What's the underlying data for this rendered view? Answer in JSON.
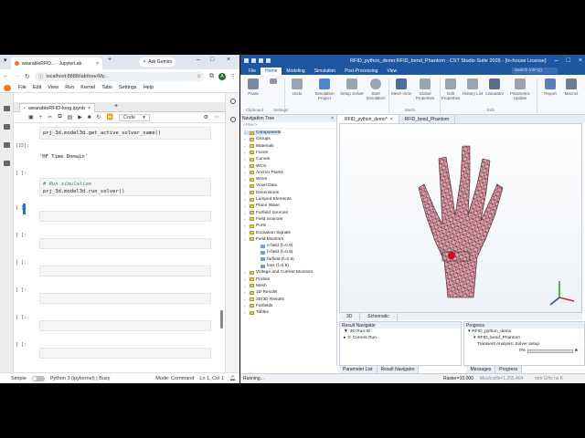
{
  "chrome": {
    "tab_title": "wearableRFID... - JupyterLab",
    "gemini_label": "Ask Gemini",
    "url": "localhost:8888/lab/tree/My...",
    "avatar_letter": "A"
  },
  "jupyter": {
    "menu": [
      "File",
      "Edit",
      "View",
      "Run",
      "Kernel",
      "Tabs",
      "Settings",
      "Help"
    ],
    "notebook_tab": "wearableRFID-long.ipynb",
    "cell_type": "Code",
    "cells": [
      {
        "prompt": "",
        "code": "prj_3d.model3d.get_active_solver_name()"
      },
      {
        "prompt": "[15]:",
        "output": "'HF Time Domain'"
      },
      {
        "prompt": "[ ]:",
        "comment": "# Run simulation",
        "code": "prj_3d.model3d.run_solver()"
      },
      {
        "prompt": "[ ]:"
      },
      {
        "prompt": "[ ]:"
      },
      {
        "prompt": "[ ]:"
      },
      {
        "prompt": "[ ]:"
      },
      {
        "prompt": "[ ]:"
      },
      {
        "prompt": "[ ]:"
      }
    ],
    "status": {
      "mode_label": "Simple",
      "kernel": "Python 3 (ipykernel) | Busy",
      "mode": "Mode: Command",
      "position": "Ln 1, Col 1"
    }
  },
  "cst": {
    "title": "RFID_python_demo:RFID_bend_Phantom - CST Studio Suite 2026 - [In-house License]",
    "tabs": [
      "File",
      "Home",
      "Modeling",
      "Simulation",
      "Post-Processing",
      "View"
    ],
    "active_tab": "Home",
    "search_placeholder": "Search (Alt+Q)",
    "ribbon": [
      {
        "label": "Paste",
        "color": "#7a8aa0"
      },
      {
        "label": "Settings",
        "color": "#8b95a6"
      },
      {
        "label": "Undo",
        "color": "#9aa4b2"
      },
      {
        "label": "Simulation Project",
        "color": "#4f87c7"
      },
      {
        "label": "Setup Solver",
        "color": "#9aa4b2"
      },
      {
        "label": "Start Simulation",
        "color": "#9aa4b2"
      },
      {
        "label": "Mesh View",
        "color": "#4f6e9a"
      },
      {
        "label": "Global Properties",
        "color": "#9aa4b2"
      },
      {
        "label": "Edit Properties",
        "color": "#9aa4b2"
      },
      {
        "label": "History List",
        "color": "#9aa4b2"
      },
      {
        "label": "Calculator",
        "color": "#5c6d87"
      },
      {
        "label": "Parametric Update",
        "color": "#9aa4b2"
      },
      {
        "label": "Report",
        "color": "#5b7fb5"
      },
      {
        "label": "Macros",
        "color": "#6f7d92"
      }
    ],
    "ribbon_groups": [
      "Clipboard",
      "Settings",
      "Mesh",
      "Edit"
    ],
    "nav_tree_title": "Navigation Tree",
    "filter_placeholder": "<Filter>",
    "nav_items": [
      "Components",
      "Groups",
      "Materials",
      "Faces",
      "Curves",
      "WCS",
      "Anchor Points",
      "Wires",
      "Voxel Data",
      "Dimensions",
      "Lumped Elements",
      "Plane Wave",
      "Farfield Sources",
      "Field Sources",
      "Ports",
      "Excitation Signals",
      "Field Monitors",
      "e-field (f=0.9)",
      "h-field (f=0.9)",
      "farfield (f=0.9)",
      "loss (f=0.9)",
      "Voltage and Current Monitors",
      "Probes",
      "Mesh",
      "1D Results",
      "2D/3D Results",
      "Farfields",
      "Tables"
    ],
    "view_tabs": [
      "RFID_python_demo*",
      "RFID_bend_Phantom"
    ],
    "view_bottom": [
      "3D",
      "Schematic"
    ],
    "result_nav": {
      "title": "Result Navigator",
      "rows": [
        "3D Run ID",
        "0: Current Run"
      ]
    },
    "progress": {
      "title": "Progress",
      "project": "RFID_python_demo",
      "sub": "RFID_bend_Phantom",
      "task": "Transient Analysis: Solver setup",
      "pct": "0%"
    },
    "bottom_tabs": [
      "Parameter List",
      "Result Navigator",
      "Messages",
      "Progress"
    ],
    "status": {
      "running": "Running...",
      "raster": "Raster=10.000",
      "mesh": "Meshcells=1,255,404",
      "units": "mm GHz ns K"
    }
  }
}
